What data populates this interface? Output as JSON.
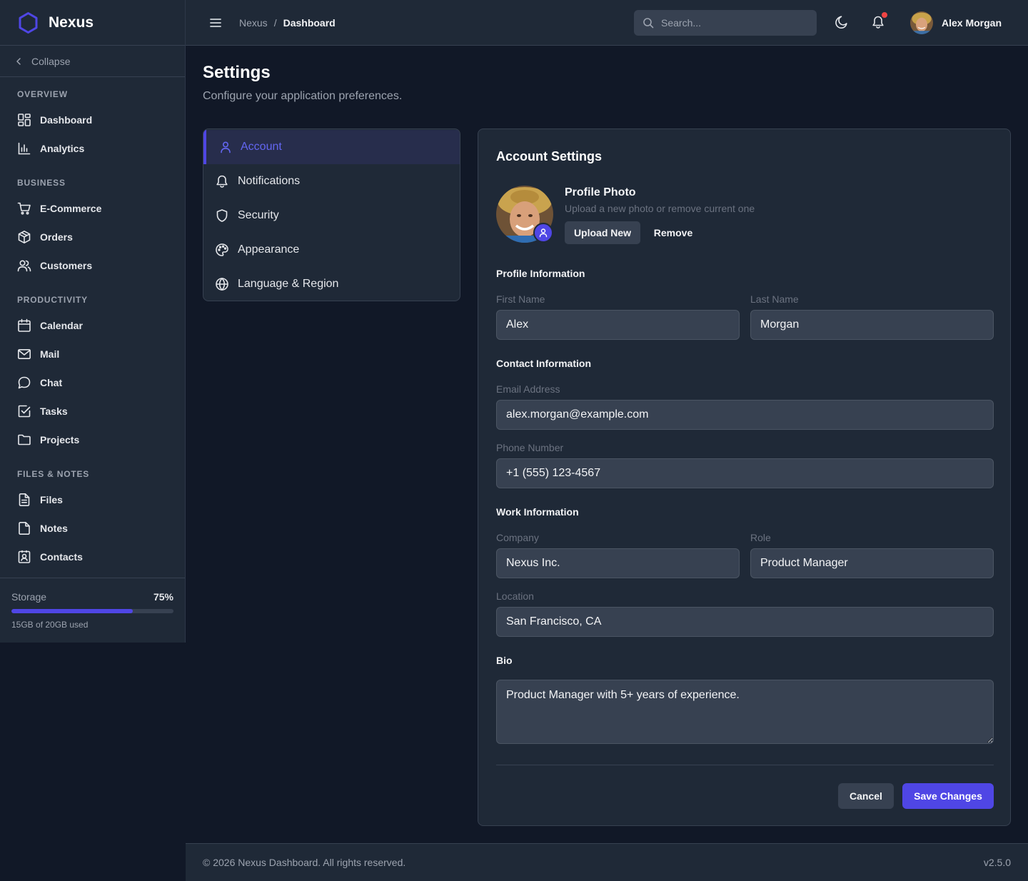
{
  "brand": {
    "name": "Nexus",
    "accent": "#4f46e5"
  },
  "sidebar": {
    "collapse_label": "Collapse",
    "sections": [
      {
        "title": "OVERVIEW",
        "items": [
          {
            "label": "Dashboard",
            "icon": "grid-icon"
          },
          {
            "label": "Analytics",
            "icon": "bar-chart-icon"
          }
        ]
      },
      {
        "title": "BUSINESS",
        "items": [
          {
            "label": "E-Commerce",
            "icon": "cart-icon"
          },
          {
            "label": "Orders",
            "icon": "box-icon"
          },
          {
            "label": "Customers",
            "icon": "users-icon"
          }
        ]
      },
      {
        "title": "PRODUCTIVITY",
        "items": [
          {
            "label": "Calendar",
            "icon": "calendar-icon"
          },
          {
            "label": "Mail",
            "icon": "mail-icon"
          },
          {
            "label": "Chat",
            "icon": "chat-icon"
          },
          {
            "label": "Tasks",
            "icon": "check-square-icon"
          },
          {
            "label": "Projects",
            "icon": "folder-icon"
          }
        ]
      },
      {
        "title": "FILES & NOTES",
        "items": [
          {
            "label": "Files",
            "icon": "file-icon"
          },
          {
            "label": "Notes",
            "icon": "note-icon"
          },
          {
            "label": "Contacts",
            "icon": "contact-card-icon"
          }
        ]
      }
    ],
    "storage": {
      "label": "Storage",
      "percent_label": "75%",
      "fraction": 0.75,
      "used_label": "15GB of 20GB used"
    }
  },
  "header": {
    "breadcrumb_root": "Nexus",
    "breadcrumb_sep": "/",
    "breadcrumb_current": "Dashboard",
    "search_placeholder": "Search...",
    "user_name": "Alex Morgan",
    "notification_dot_color": "#ef4444"
  },
  "page": {
    "title": "Settings",
    "subtitle": "Configure your application preferences."
  },
  "tabs": [
    {
      "label": "Account",
      "icon": "user-icon",
      "active": true
    },
    {
      "label": "Notifications",
      "icon": "bell-icon",
      "active": false
    },
    {
      "label": "Security",
      "icon": "shield-icon",
      "active": false
    },
    {
      "label": "Appearance",
      "icon": "palette-icon",
      "active": false
    },
    {
      "label": "Language & Region",
      "icon": "globe-icon",
      "active": false
    }
  ],
  "account": {
    "title": "Account Settings",
    "photo": {
      "title": "Profile Photo",
      "subtitle": "Upload a new photo or remove current one",
      "upload_label": "Upload New",
      "remove_label": "Remove"
    },
    "profile_info": {
      "heading": "Profile Information",
      "first_name_label": "First Name",
      "first_name": "Alex",
      "last_name_label": "Last Name",
      "last_name": "Morgan"
    },
    "contact_info": {
      "heading": "Contact Information",
      "email_label": "Email Address",
      "email": "alex.morgan@example.com",
      "phone_label": "Phone Number",
      "phone": "+1 (555) 123-4567"
    },
    "work_info": {
      "heading": "Work Information",
      "company_label": "Company",
      "company": "Nexus Inc.",
      "role_label": "Role",
      "role": "Product Manager",
      "location_label": "Location",
      "location": "San Francisco, CA"
    },
    "bio": {
      "heading": "Bio",
      "value": "Product Manager with 5+ years of experience."
    },
    "cancel_label": "Cancel",
    "save_label": "Save Changes"
  },
  "footer": {
    "copyright": "© 2026 Nexus Dashboard. All rights reserved.",
    "version": "v2.5.0"
  }
}
